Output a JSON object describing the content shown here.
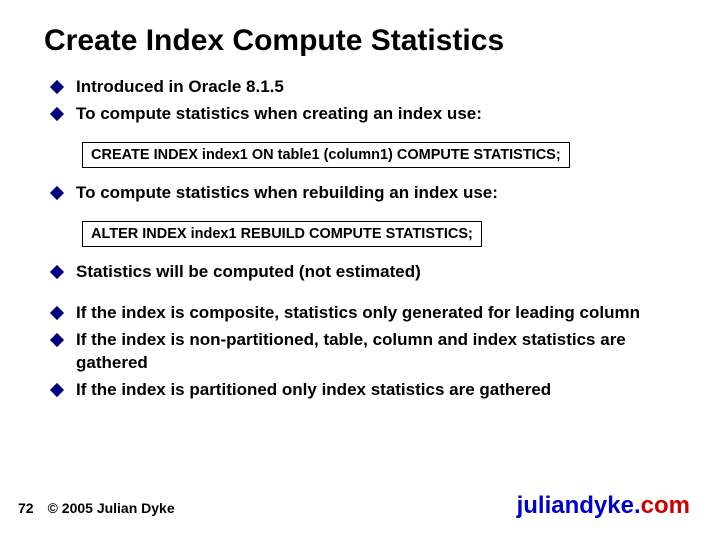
{
  "title": "Create Index Compute Statistics",
  "bullets": {
    "b1": "Introduced in Oracle 8.1.5",
    "b2": "To compute statistics when creating an index use:",
    "b3": "To compute statistics when rebuilding an index use:",
    "b4": "Statistics will be computed (not estimated)",
    "b5": "If the index is composite, statistics only generated for leading column",
    "b6": "If the index is non-partitioned, table, column and index statistics are gathered",
    "b7": "If the index is partitioned only index statistics are gathered"
  },
  "code": {
    "c1": "CREATE INDEX index1 ON table1 (column1) COMPUTE STATISTICS;",
    "c2": "ALTER INDEX index1 REBUILD COMPUTE STATISTICS;"
  },
  "footer": {
    "page": "72",
    "copyright": "© 2005 Julian Dyke",
    "site_main": "juliandyke.",
    "site_tld": "com"
  }
}
